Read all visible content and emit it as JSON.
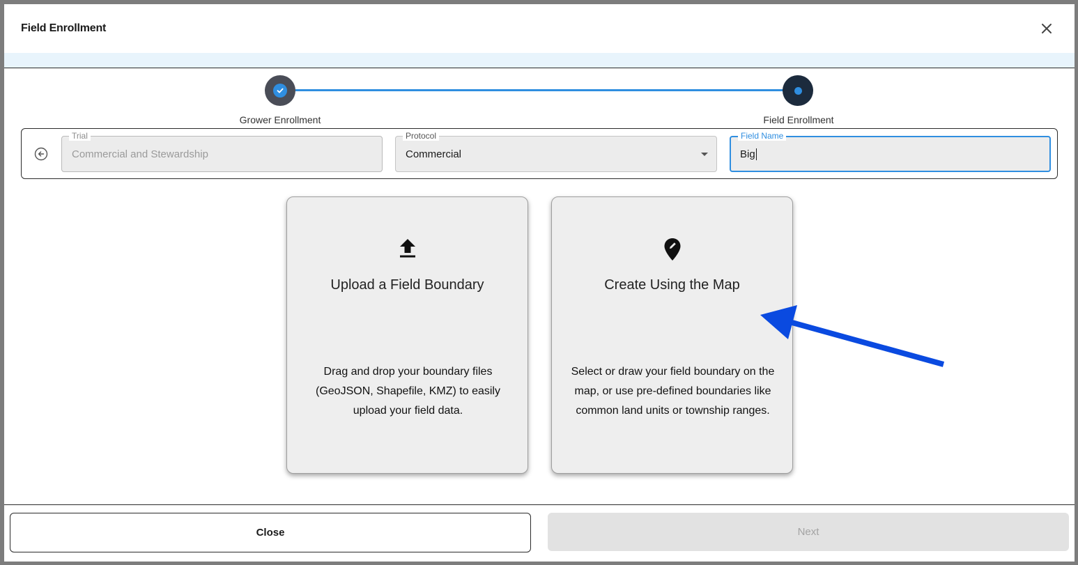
{
  "modal": {
    "title": "Field Enrollment",
    "close_icon": "close-icon"
  },
  "stepper": {
    "steps": [
      {
        "label": "Grower Enrollment",
        "status": "complete"
      },
      {
        "label": "Field Enrollment",
        "status": "active"
      }
    ],
    "accent_color": "#2f8ee0"
  },
  "form": {
    "back_icon": "arrow-left-circle-icon",
    "trial": {
      "label": "Trial",
      "value": "Commercial and Stewardship"
    },
    "protocol": {
      "label": "Protocol",
      "value": "Commercial"
    },
    "field_name": {
      "label": "Field Name",
      "value": "Big"
    }
  },
  "options": [
    {
      "icon": "upload-icon",
      "title": "Upload a Field Boundary",
      "description": "Drag and drop your boundary files (GeoJSON, Shapefile, KMZ) to easily upload your field data."
    },
    {
      "icon": "map-pin-edit-icon",
      "title": "Create Using the Map",
      "description": "Select or draw your field boundary on the map, or use pre-defined boundaries like common land units or township ranges."
    }
  ],
  "annotation": {
    "type": "arrow",
    "color": "#0a4ae0"
  },
  "footer": {
    "close_label": "Close",
    "next_label": "Next"
  }
}
